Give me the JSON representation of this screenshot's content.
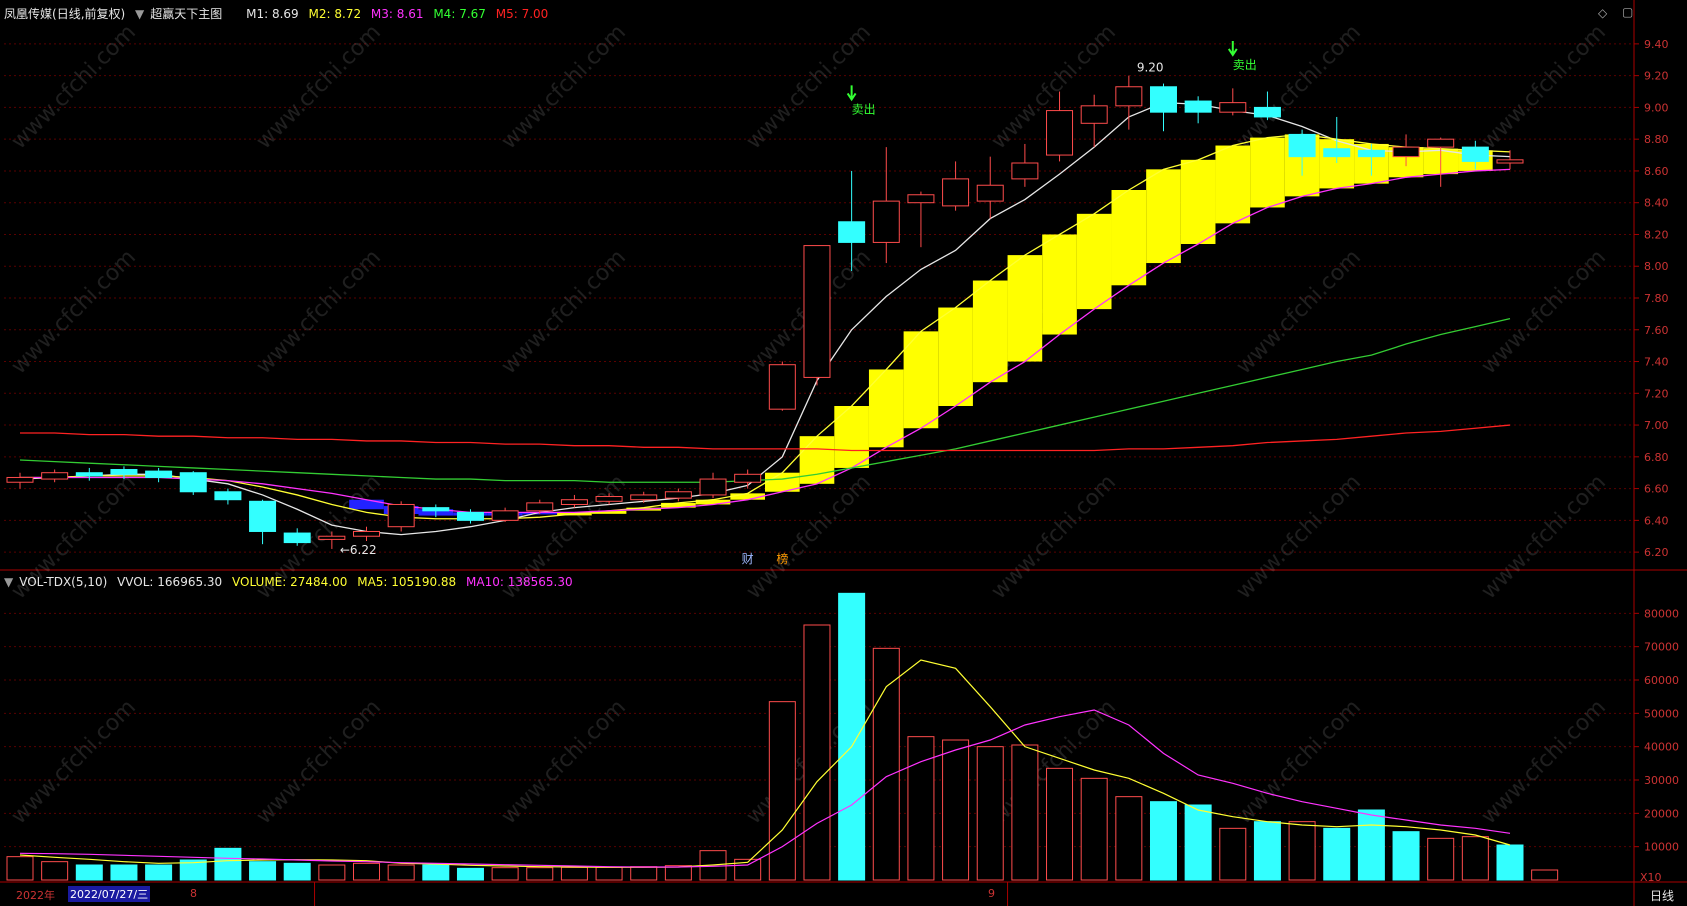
{
  "header": {
    "stock_name": "凤凰传媒",
    "period": "(日线,前复权)",
    "indicator_name": "超赢天下主图",
    "ma": [
      {
        "label": "M1:",
        "value": "8.69",
        "color": "#e6e6e6"
      },
      {
        "label": "M2:",
        "value": "8.72",
        "color": "#ffff33"
      },
      {
        "label": "M3:",
        "value": "8.61",
        "color": "#ff33ff"
      },
      {
        "label": "M4:",
        "value": "7.67",
        "color": "#33cc33"
      },
      {
        "label": "M5:",
        "value": "7.00",
        "color": "#ff2222"
      }
    ]
  },
  "vol_header": {
    "name": "VOL-TDX(5,10)",
    "vvol_label": "VVOL: 166965.30",
    "volume_label": "VOLUME: 27484.00",
    "ma5_label": "MA5: 105190.88",
    "ma10_label": "MA10: 138565.30"
  },
  "bottom_bar": {
    "year": "2022年",
    "date": "2022/07/27/三",
    "month_aug": "8",
    "month_sep": "9",
    "period_btn": "日线",
    "scale": "X10"
  },
  "watermark": "www.cfchi.com",
  "colors": {
    "up": "#ff4c4c",
    "down": "#33ffff",
    "grid": "#5a0000",
    "axis": "#aa0000",
    "ribbon": "#ffff00",
    "ribbon_down": "#2222ff"
  },
  "chart_data": [
    {
      "type": "candlestick",
      "title": "超赢天下主图",
      "ylim": [
        6.1,
        9.5
      ],
      "yticks": [
        6.2,
        6.4,
        6.6,
        6.8,
        7.0,
        7.2,
        7.4,
        7.6,
        7.8,
        8.0,
        8.2,
        8.4,
        8.6,
        8.8,
        9.0,
        9.2,
        9.4
      ],
      "candles": [
        {
          "o": 6.64,
          "c": 6.67,
          "h": 6.7,
          "l": 6.6
        },
        {
          "o": 6.66,
          "c": 6.7,
          "h": 6.72,
          "l": 6.64
        },
        {
          "o": 6.7,
          "c": 6.68,
          "h": 6.73,
          "l": 6.65
        },
        {
          "o": 6.72,
          "c": 6.69,
          "h": 6.74,
          "l": 6.66
        },
        {
          "o": 6.71,
          "c": 6.67,
          "h": 6.73,
          "l": 6.64
        },
        {
          "o": 6.7,
          "c": 6.58,
          "h": 6.71,
          "l": 6.56
        },
        {
          "o": 6.58,
          "c": 6.53,
          "h": 6.6,
          "l": 6.5
        },
        {
          "o": 6.52,
          "c": 6.33,
          "h": 6.53,
          "l": 6.25
        },
        {
          "o": 6.32,
          "c": 6.26,
          "h": 6.35,
          "l": 6.24
        },
        {
          "o": 6.28,
          "c": 6.3,
          "h": 6.33,
          "l": 6.22
        },
        {
          "o": 6.3,
          "c": 6.33,
          "h": 6.36,
          "l": 6.27
        },
        {
          "o": 6.36,
          "c": 6.5,
          "h": 6.52,
          "l": 6.33
        },
        {
          "o": 6.48,
          "c": 6.46,
          "h": 6.5,
          "l": 6.42
        },
        {
          "o": 6.45,
          "c": 6.4,
          "h": 6.47,
          "l": 6.38
        },
        {
          "o": 6.4,
          "c": 6.46,
          "h": 6.48,
          "l": 6.39
        },
        {
          "o": 6.46,
          "c": 6.51,
          "h": 6.53,
          "l": 6.44
        },
        {
          "o": 6.5,
          "c": 6.53,
          "h": 6.56,
          "l": 6.48
        },
        {
          "o": 6.52,
          "c": 6.55,
          "h": 6.57,
          "l": 6.5
        },
        {
          "o": 6.53,
          "c": 6.56,
          "h": 6.58,
          "l": 6.51
        },
        {
          "o": 6.54,
          "c": 6.58,
          "h": 6.6,
          "l": 6.52
        },
        {
          "o": 6.56,
          "c": 6.66,
          "h": 6.7,
          "l": 6.54
        },
        {
          "o": 6.64,
          "c": 6.69,
          "h": 6.72,
          "l": 6.6
        },
        {
          "o": 7.1,
          "c": 7.38,
          "h": 7.4,
          "l": 7.09
        },
        {
          "o": 7.3,
          "c": 8.13,
          "h": 8.13,
          "l": 7.25
        },
        {
          "o": 8.28,
          "c": 8.15,
          "h": 8.6,
          "l": 7.97
        },
        {
          "o": 8.15,
          "c": 8.41,
          "h": 8.75,
          "l": 8.02
        },
        {
          "o": 8.4,
          "c": 8.45,
          "h": 8.47,
          "l": 8.12
        },
        {
          "o": 8.38,
          "c": 8.55,
          "h": 8.66,
          "l": 8.35
        },
        {
          "o": 8.41,
          "c": 8.51,
          "h": 8.69,
          "l": 8.3
        },
        {
          "o": 8.55,
          "c": 8.65,
          "h": 8.77,
          "l": 8.5
        },
        {
          "o": 8.7,
          "c": 8.98,
          "h": 9.1,
          "l": 8.66
        },
        {
          "o": 8.9,
          "c": 9.01,
          "h": 9.08,
          "l": 8.75
        },
        {
          "o": 9.01,
          "c": 9.13,
          "h": 9.2,
          "l": 8.86
        },
        {
          "o": 9.13,
          "c": 8.97,
          "h": 9.15,
          "l": 8.85
        },
        {
          "o": 9.04,
          "c": 8.97,
          "h": 9.07,
          "l": 8.9
        },
        {
          "o": 8.97,
          "c": 9.03,
          "h": 9.12,
          "l": 8.95
        },
        {
          "o": 9.0,
          "c": 8.94,
          "h": 9.1,
          "l": 8.92
        },
        {
          "o": 8.83,
          "c": 8.69,
          "h": 8.86,
          "l": 8.57
        },
        {
          "o": 8.74,
          "c": 8.69,
          "h": 8.94,
          "l": 8.65
        },
        {
          "o": 8.73,
          "c": 8.69,
          "h": 8.77,
          "l": 8.57
        },
        {
          "o": 8.69,
          "c": 8.75,
          "h": 8.83,
          "l": 8.63
        },
        {
          "o": 8.75,
          "c": 8.8,
          "h": 8.81,
          "l": 8.5
        },
        {
          "o": 8.75,
          "c": 8.66,
          "h": 8.79,
          "l": 8.61
        },
        {
          "o": 8.65,
          "c": 8.67,
          "h": 8.73,
          "l": 8.61
        }
      ],
      "lines": [
        {
          "name": "M1",
          "color": "#e6e6e6",
          "values": [
            6.66,
            6.67,
            6.68,
            6.69,
            6.69,
            6.66,
            6.63,
            6.56,
            6.47,
            6.37,
            6.33,
            6.31,
            6.33,
            6.36,
            6.4,
            6.45,
            6.48,
            6.5,
            6.52,
            6.54,
            6.57,
            6.62,
            6.8,
            7.28,
            7.6,
            7.81,
            7.98,
            8.1,
            8.3,
            8.42,
            8.58,
            8.75,
            8.94,
            9.03,
            9.02,
            8.98,
            8.95,
            8.88,
            8.79,
            8.73,
            8.72,
            8.73,
            8.7,
            8.69
          ]
        },
        {
          "name": "M2",
          "color": "#ffff33",
          "values": [
            6.67,
            6.67,
            6.68,
            6.68,
            6.68,
            6.67,
            6.65,
            6.61,
            6.56,
            6.5,
            6.45,
            6.42,
            6.41,
            6.41,
            6.41,
            6.42,
            6.44,
            6.46,
            6.48,
            6.51,
            6.53,
            6.57,
            6.7,
            6.93,
            7.12,
            7.35,
            7.59,
            7.74,
            7.91,
            8.07,
            8.2,
            8.33,
            8.48,
            8.61,
            8.67,
            8.76,
            8.81,
            8.83,
            8.8,
            8.77,
            8.75,
            8.74,
            8.73,
            8.72
          ]
        },
        {
          "name": "M3",
          "color": "#ff33ff",
          "values": [
            6.67,
            6.67,
            6.67,
            6.67,
            6.67,
            6.66,
            6.65,
            6.63,
            6.6,
            6.57,
            6.53,
            6.49,
            6.47,
            6.45,
            6.45,
            6.45,
            6.45,
            6.46,
            6.47,
            6.48,
            6.5,
            6.53,
            6.58,
            6.63,
            6.73,
            6.86,
            6.98,
            7.12,
            7.27,
            7.4,
            7.57,
            7.73,
            7.88,
            8.02,
            8.14,
            8.27,
            8.37,
            8.44,
            8.49,
            8.52,
            8.56,
            8.58,
            8.6,
            8.61
          ]
        },
        {
          "name": "M4",
          "color": "#33cc33",
          "values": [
            6.78,
            6.77,
            6.76,
            6.75,
            6.74,
            6.73,
            6.72,
            6.71,
            6.7,
            6.69,
            6.68,
            6.67,
            6.66,
            6.66,
            6.65,
            6.65,
            6.65,
            6.64,
            6.64,
            6.64,
            6.64,
            6.65,
            6.66,
            6.69,
            6.73,
            6.77,
            6.81,
            6.85,
            6.9,
            6.95,
            7.0,
            7.05,
            7.1,
            7.15,
            7.2,
            7.25,
            7.3,
            7.35,
            7.4,
            7.44,
            7.51,
            7.57,
            7.62,
            7.67
          ]
        },
        {
          "name": "M5",
          "color": "#ff2222",
          "values": [
            6.95,
            6.95,
            6.94,
            6.94,
            6.93,
            6.93,
            6.92,
            6.92,
            6.91,
            6.91,
            6.9,
            6.9,
            6.89,
            6.89,
            6.88,
            6.88,
            6.87,
            6.87,
            6.86,
            6.86,
            6.85,
            6.85,
            6.85,
            6.85,
            6.84,
            6.84,
            6.84,
            6.84,
            6.84,
            6.84,
            6.84,
            6.84,
            6.85,
            6.85,
            6.86,
            6.87,
            6.89,
            6.9,
            6.91,
            6.93,
            6.95,
            6.96,
            6.98,
            7.0
          ]
        }
      ],
      "annotations": [
        {
          "text": "←6.22",
          "candle": 9,
          "price": 6.22
        },
        {
          "text": "9.20",
          "candle": 32,
          "price": 9.2
        },
        {
          "text": "卖出",
          "candle": 24,
          "price": 9.0,
          "color": "#33ff33"
        },
        {
          "text": "卖出",
          "candle": 35,
          "price": 9.28,
          "color": "#33ff33"
        },
        {
          "text": "财",
          "candle": 21,
          "price": 6.13,
          "color": "#9fb8ff"
        },
        {
          "text": "榜",
          "candle": 22,
          "price": 6.13,
          "color": "#ff9900"
        }
      ]
    },
    {
      "type": "bar",
      "title": "VOL-TDX(5,10)",
      "ylim": [
        0,
        87000
      ],
      "yticks": [
        10000,
        20000,
        30000,
        40000,
        50000,
        60000,
        70000,
        80000
      ],
      "volume": [
        7000,
        5500,
        4500,
        4500,
        4500,
        6000,
        9500,
        5500,
        5000,
        4500,
        5000,
        4500,
        4500,
        3500,
        3700,
        3700,
        3800,
        3800,
        4000,
        4300,
        8800,
        6200,
        53500,
        76500,
        86000,
        69500,
        43000,
        42000,
        40000,
        40500,
        33500,
        30500,
        25000,
        23500,
        22500,
        15500,
        17500,
        17500,
        15500,
        21000,
        14500,
        12500,
        13000,
        10500,
        3000
      ],
      "direction": [
        "up",
        "up",
        "down",
        "down",
        "down",
        "down",
        "down",
        "down",
        "down",
        "up",
        "up",
        "up",
        "down",
        "down",
        "up",
        "up",
        "up",
        "up",
        "up",
        "up",
        "up",
        "up",
        "up",
        "up",
        "down",
        "up",
        "up",
        "up",
        "up",
        "up",
        "up",
        "up",
        "up",
        "down",
        "down",
        "up",
        "down",
        "up",
        "down",
        "down",
        "down",
        "up",
        "up",
        "down",
        "up"
      ],
      "ma5": [
        7500,
        6800,
        6200,
        5500,
        5000,
        5200,
        5800,
        6000,
        6100,
        6000,
        5800,
        5000,
        4800,
        4400,
        4200,
        4000,
        3900,
        3800,
        3800,
        3900,
        4500,
        5300,
        15000,
        29500,
        40000,
        58000,
        66000,
        63500,
        52000,
        40000,
        36500,
        33000,
        30500,
        26000,
        21000,
        19000,
        17500,
        16500,
        16000,
        16500,
        16000,
        15000,
        13500,
        10500
      ],
      "ma10": [
        8000,
        7900,
        7700,
        7400,
        7100,
        6800,
        6500,
        6300,
        6000,
        5700,
        5500,
        5200,
        5000,
        4800,
        4600,
        4400,
        4200,
        4000,
        3900,
        3900,
        4100,
        4500,
        10000,
        17000,
        22500,
        31000,
        35500,
        39000,
        42000,
        46500,
        49000,
        51000,
        46500,
        38000,
        31500,
        29000,
        26000,
        23500,
        21500,
        19500,
        18000,
        16500,
        15500,
        14000
      ]
    }
  ]
}
